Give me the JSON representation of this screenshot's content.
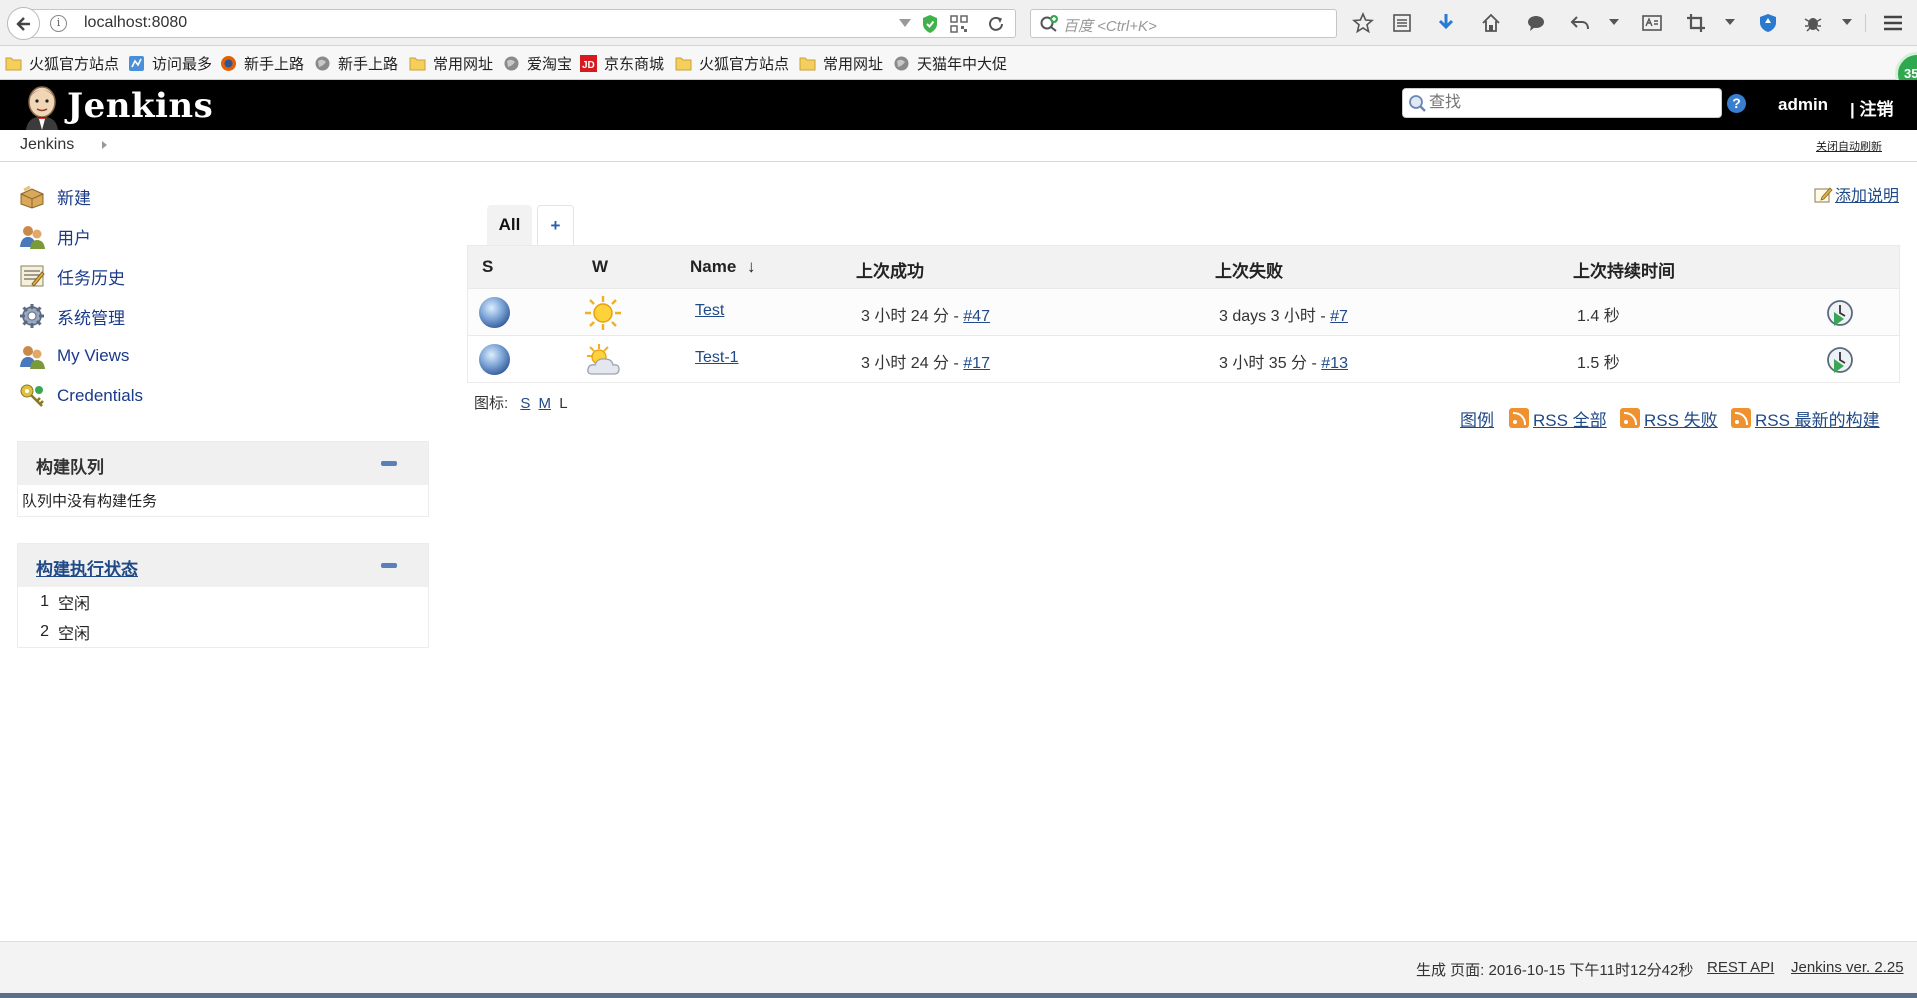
{
  "browser": {
    "url": "localhost:8080",
    "search_placeholder": "百度 <Ctrl+K>",
    "bookmarks": [
      {
        "label": "火狐官方站点",
        "icon": "folder-icon"
      },
      {
        "label": "访问最多",
        "icon": "bookmark-most-visited-icon"
      },
      {
        "label": "新手上路",
        "icon": "firefox-icon"
      },
      {
        "label": "新手上路",
        "icon": "globe-icon"
      },
      {
        "label": "常用网址",
        "icon": "folder-icon"
      },
      {
        "label": "爱淘宝",
        "icon": "globe-icon"
      },
      {
        "label": "京东商城",
        "icon": "jd-icon"
      },
      {
        "label": "火狐官方站点",
        "icon": "folder-icon"
      },
      {
        "label": "常用网址",
        "icon": "folder-icon"
      },
      {
        "label": "天猫年中大促",
        "icon": "globe-icon"
      }
    ],
    "badge": "35"
  },
  "header": {
    "title": "Jenkins",
    "search_placeholder": "查找",
    "help": "?",
    "user": "admin",
    "logout": "| 注销"
  },
  "breadcrumb": {
    "root": "Jenkins",
    "auto_refresh": "关闭自动刷新"
  },
  "sidebar": {
    "tasks": [
      {
        "label": "新建",
        "icon": "new-item-icon"
      },
      {
        "label": "用户",
        "icon": "users-icon"
      },
      {
        "label": "任务历史",
        "icon": "build-history-icon"
      },
      {
        "label": "系统管理",
        "icon": "manage-gear-icon"
      },
      {
        "label": "My Views",
        "icon": "my-views-icon"
      },
      {
        "label": "Credentials",
        "icon": "credentials-icon"
      }
    ],
    "build_queue": {
      "title": "构建队列",
      "empty": "队列中没有构建任务"
    },
    "executors": {
      "title": "构建执行状态",
      "rows": [
        {
          "num": "1",
          "status": "空闲"
        },
        {
          "num": "2",
          "status": "空闲"
        }
      ]
    }
  },
  "main": {
    "add_description": "添加说明",
    "tabs": {
      "all": "All",
      "add": "+"
    },
    "columns": {
      "s": "S",
      "w": "W",
      "name": "Name",
      "sort_arrow": "↓",
      "last_success": "上次成功",
      "last_failure": "上次失败",
      "last_duration": "上次持续时间"
    },
    "jobs": [
      {
        "status": "blue",
        "weather": "sunny",
        "name": "Test",
        "last_success_time": "3 小时 24 分 - ",
        "last_success_build": "#47",
        "last_failure_time": "3 days 3 小时 - ",
        "last_failure_build": "#7",
        "duration": "1.4 秒"
      },
      {
        "status": "blue",
        "weather": "partly-cloudy",
        "name": "Test-1",
        "last_success_time": "3 小时 24 分 - ",
        "last_success_build": "#17",
        "last_failure_time": "3 小时 35 分 - ",
        "last_failure_build": "#13",
        "duration": "1.5 秒"
      }
    ],
    "icon_size": {
      "label": "图标:",
      "s": "S",
      "m": "M",
      "l": "L"
    },
    "links": {
      "legend": "图例",
      "rss_all": "RSS 全部",
      "rss_failed": "RSS 失败",
      "rss_latest": "RSS 最新的构建"
    }
  },
  "footer": {
    "generated": "生成 页面: 2016-10-15 下午11时12分42秒",
    "rest_api": "REST API",
    "version": "Jenkins ver. 2.25"
  }
}
